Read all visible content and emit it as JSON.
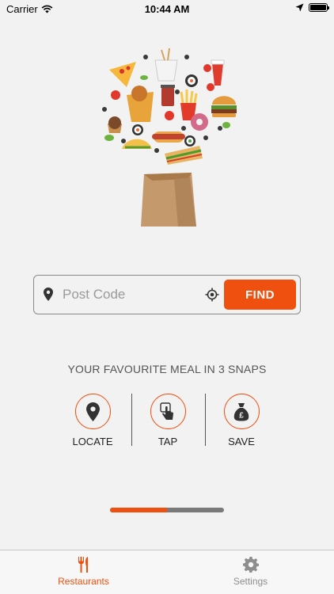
{
  "status_bar": {
    "carrier": "Carrier",
    "time": "10:44 AM"
  },
  "search": {
    "placeholder": "Post Code",
    "value": "",
    "find_label": "FIND"
  },
  "tagline": "YOUR FAVOURITE MEAL IN 3 SNAPS",
  "steps": [
    {
      "label": "LOCATE",
      "icon": "location-pin-icon"
    },
    {
      "label": "TAP",
      "icon": "tap-finger-icon"
    },
    {
      "label": "SAVE",
      "icon": "money-bag-icon"
    }
  ],
  "onboarding_progress": 0.5,
  "tabs": [
    {
      "label": "Restaurants",
      "icon": "fork-knife-icon",
      "active": true
    },
    {
      "label": "Settings",
      "icon": "gear-icon",
      "active": false
    }
  ],
  "colors": {
    "accent": "#f0500f",
    "background": "#f2f2f2",
    "inactive": "#8e8e8e"
  }
}
